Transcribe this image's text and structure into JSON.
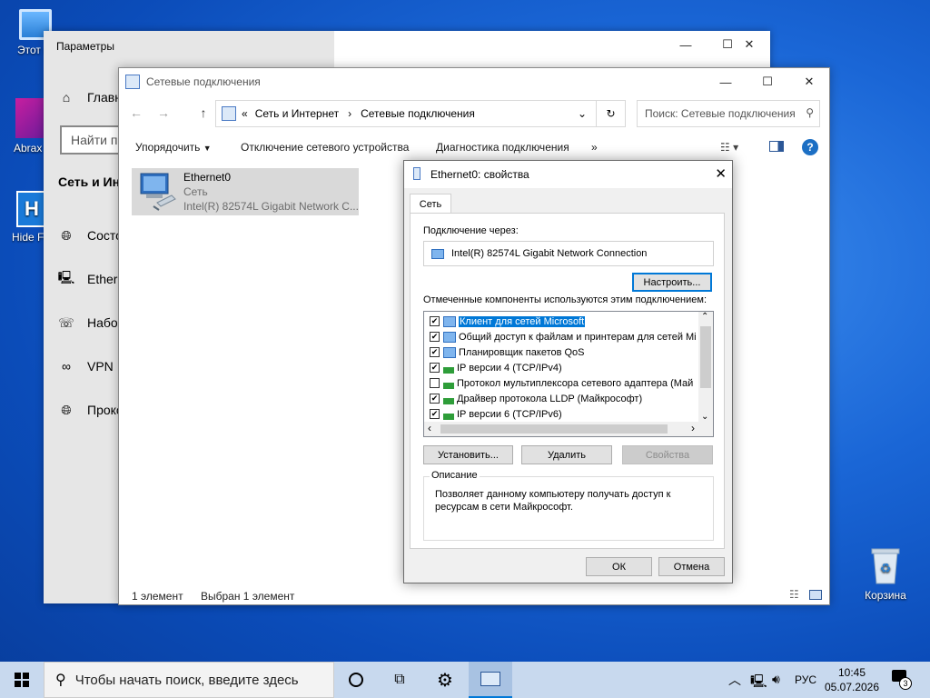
{
  "desktop": {
    "icons": [
      {
        "label": "Этот компьютер",
        "name": "this-pc-icon"
      },
      {
        "label": "Abrax",
        "name": "abrax-icon"
      },
      {
        "label": "Hide Fo",
        "name": "hide-folders-icon"
      },
      {
        "label": "Корзина",
        "name": "recycle-bin-icon"
      }
    ]
  },
  "settings": {
    "title": "Параметры",
    "home": "Главн",
    "search_placeholder": "Найти па",
    "section": "Сеть и Инт",
    "items": [
      "Состо",
      "Ethern",
      "Набор",
      "VPN",
      "Прокс"
    ]
  },
  "explorer": {
    "title": "Сетевые подключения",
    "breadcrumb": [
      "Сеть и Интернет",
      "Сетевые подключения"
    ],
    "breadcrumb_prefix": "«",
    "search_placeholder": "Поиск: Сетевые подключения",
    "commands": [
      "Упорядочить",
      "Отключение сетевого устройства",
      "Диагностика подключения",
      "»"
    ],
    "item": {
      "name": "Ethernet0",
      "type": "Сеть",
      "adapter": "Intel(R) 82574L Gigabit Network C..."
    },
    "status_count": "1 элемент",
    "status_selected": "Выбран 1 элемент"
  },
  "dialog": {
    "title": "Ethernet0: свойства",
    "tab": "Сеть",
    "connect_using_label": "Подключение через:",
    "adapter": "Intel(R) 82574L Gigabit Network Connection",
    "configure": "Настроить...",
    "components_label": "Отмеченные компоненты используются этим подключением:",
    "components": [
      {
        "label": "Клиент для сетей Microsoft",
        "checked": true,
        "selected": true,
        "icon": "network-client-icon"
      },
      {
        "label": "Общий доступ к файлам и принтерам для сетей Mi",
        "checked": true,
        "selected": false,
        "icon": "network-client-icon"
      },
      {
        "label": "Планировщик пакетов QoS",
        "checked": true,
        "selected": false,
        "icon": "network-client-icon"
      },
      {
        "label": "IP версии 4 (TCP/IPv4)",
        "checked": true,
        "selected": false,
        "icon": "protocol-icon"
      },
      {
        "label": "Протокол мультиплексора сетевого адаптера (Май",
        "checked": false,
        "selected": false,
        "icon": "protocol-icon"
      },
      {
        "label": "Драйвер протокола LLDP (Майкрософт)",
        "checked": true,
        "selected": false,
        "icon": "protocol-icon"
      },
      {
        "label": "IP версии 6 (TCP/IPv6)",
        "checked": true,
        "selected": false,
        "icon": "protocol-icon"
      }
    ],
    "install": "Установить...",
    "uninstall": "Удалить",
    "properties": "Свойства",
    "description_label": "Описание",
    "description": "Позволяет данному компьютеру получать доступ к ресурсам в сети Майкрософт.",
    "ok": "ОК",
    "cancel": "Отмена"
  },
  "taskbar": {
    "search_placeholder": "Чтобы начать поиск, введите здесь",
    "language": "РУС",
    "time": "10:45",
    "date": "05.07.2026",
    "notifications": "3"
  },
  "colors": {
    "accent": "#0078d7",
    "selection": "#0078d7",
    "taskbar": "#c8d9ee"
  }
}
